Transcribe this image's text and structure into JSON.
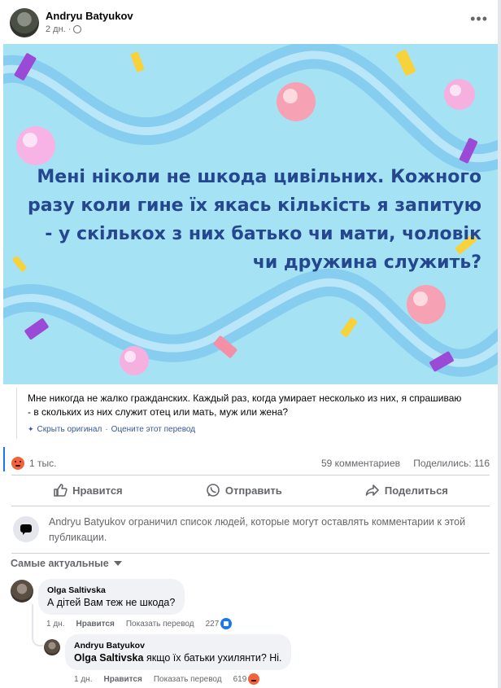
{
  "post": {
    "author": "Andryu Batyukov",
    "time": "2 дн.",
    "privacy_icon": "globe-icon",
    "more_icon": "more-options-icon",
    "banner_text": "Мені ніколи не шкода цивільних. Кожного разу коли гине їх якась кількість я запитую - у скількох з них батько чи мати, чоловік чи дружина служить?",
    "banner_colors": {
      "background": "#a5e3f4",
      "text": "#25478f"
    },
    "translation": "Мне никогда не жалко гражданских. Каждый раз, когда умирает несколько из них, я спрашиваю - в скольких из них служит отец или мать, муж или жена?",
    "hide_original": "Скрыть оригинал",
    "rate_translation": "Оцените этот перевод",
    "separator": "·"
  },
  "stats": {
    "reaction_icon": "angry-reaction-icon",
    "reactions": "1 тыс.",
    "comments": "59 комментариев",
    "shares": "Поделились: 116"
  },
  "actions": {
    "like": "Нравится",
    "send": "Отправить",
    "share": "Поделиться"
  },
  "notice": {
    "icon": "comment-restricted-icon",
    "text": "Andryu Batyukov ограничил список людей, которые могут оставлять комментарии к этой публикации."
  },
  "sort": {
    "label": "Самые актуальные"
  },
  "comments": [
    {
      "author": "Olga Saltivska",
      "text": "А дітей Вам теж не шкода?",
      "time": "1 дн.",
      "like": "Нравится",
      "translate": "Показать перевод",
      "count": "227",
      "reaction_icon": "like-reaction-icon"
    },
    {
      "author": "Andryu Batyukov",
      "mention": "Olga Saltivska",
      "text": "якщо їх батьки ухилянти? Ні.",
      "time": "1 дн.",
      "like": "Нравится",
      "translate": "Показать перевод",
      "count": "619",
      "reaction_icon": "angry-reaction-icon"
    }
  ]
}
